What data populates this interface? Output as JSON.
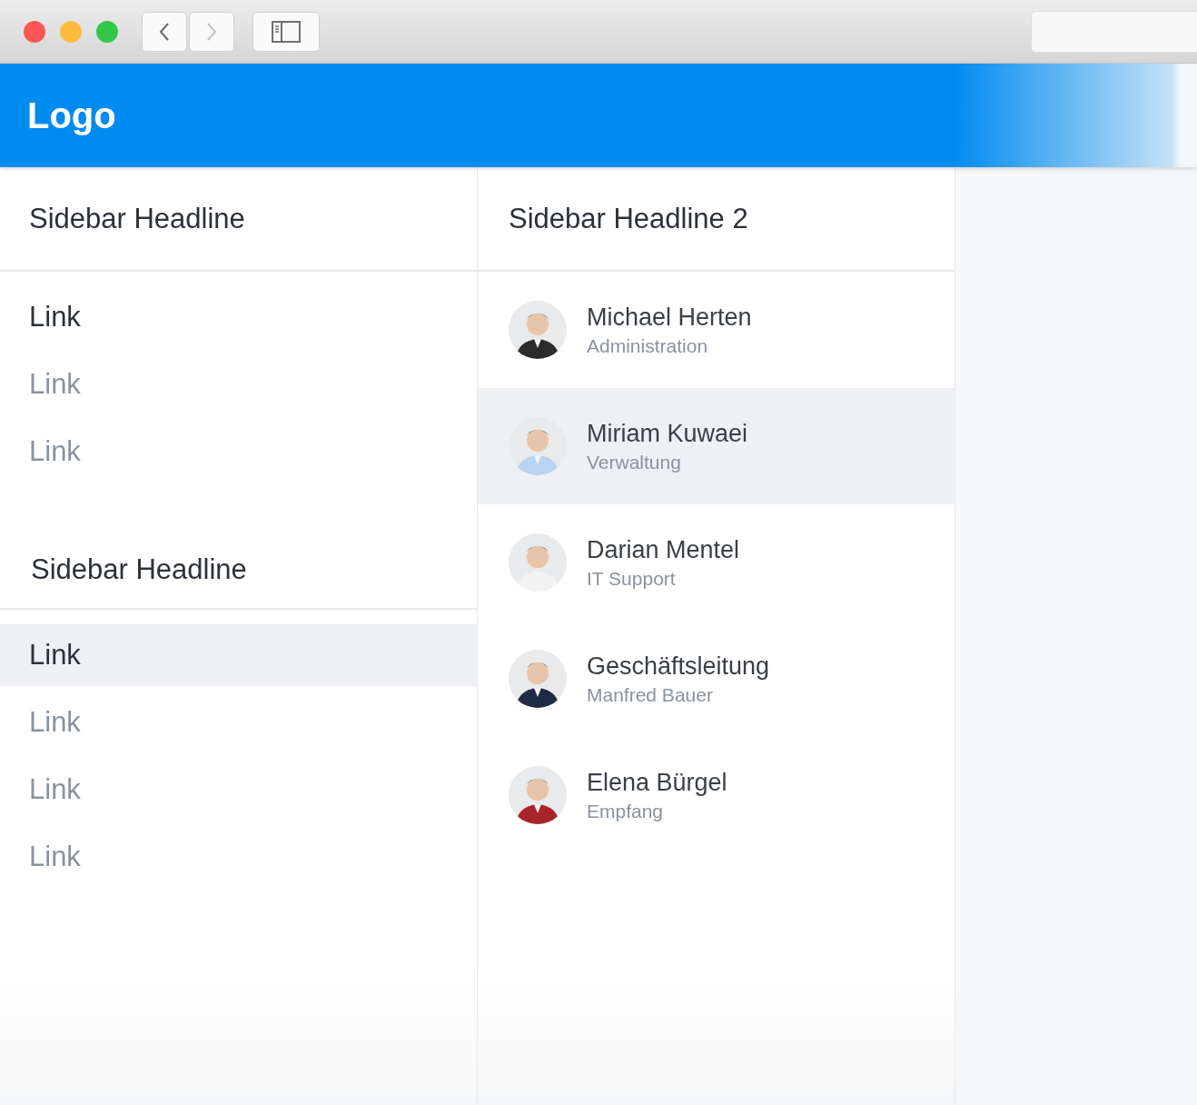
{
  "toolbar": {
    "back_enabled": true,
    "forward_enabled": false
  },
  "header": {
    "logo": "Logo"
  },
  "sidebar": {
    "groups": [
      {
        "headline": "Sidebar Headline",
        "links": [
          {
            "label": "Link",
            "active": true,
            "highlighted": false
          },
          {
            "label": "Link",
            "active": false,
            "highlighted": false
          },
          {
            "label": "Link",
            "active": false,
            "highlighted": false
          }
        ]
      },
      {
        "headline": "Sidebar Headline",
        "links": [
          {
            "label": "Link",
            "active": true,
            "highlighted": true
          },
          {
            "label": "Link",
            "active": false,
            "highlighted": false
          },
          {
            "label": "Link",
            "active": false,
            "highlighted": false
          },
          {
            "label": "Link",
            "active": false,
            "highlighted": false
          }
        ]
      }
    ]
  },
  "people_panel": {
    "headline": "Sidebar Headline 2",
    "people": [
      {
        "title": "Michael Herten",
        "subtitle": "Administration",
        "selected": false
      },
      {
        "title": "Miriam Kuwaei",
        "subtitle": "Verwaltung",
        "selected": true
      },
      {
        "title": "Darian Mentel",
        "subtitle": "IT Support",
        "selected": false
      },
      {
        "title": "Geschäftsleitung",
        "subtitle": "Manfred Bauer",
        "selected": false
      },
      {
        "title": "Elena Bürgel",
        "subtitle": "Empfang",
        "selected": false
      }
    ]
  }
}
